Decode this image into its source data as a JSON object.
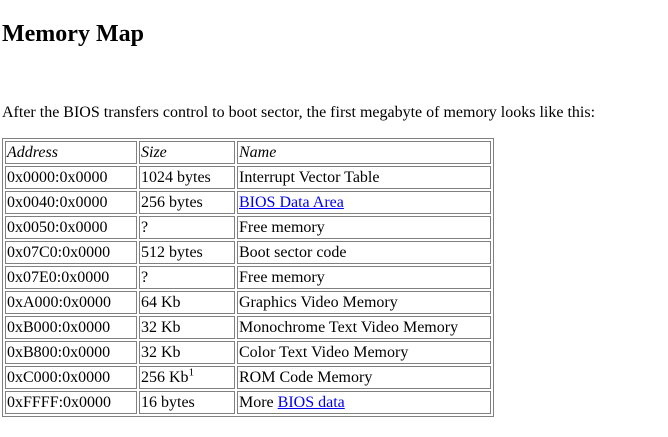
{
  "title": "Memory Map",
  "intro": "After the BIOS transfers control to boot sector, the first megabyte of memory looks like this:",
  "table": {
    "headers": [
      "Address",
      "Size",
      "Name"
    ],
    "rows": [
      {
        "address": "0x0000:0x0000",
        "size": "1024 bytes",
        "name": "Interrupt Vector Table"
      },
      {
        "address": "0x0040:0x0000",
        "size": "256 bytes",
        "name_link": "BIOS Data Area"
      },
      {
        "address": "0x0050:0x0000",
        "size": "?",
        "name": "Free memory"
      },
      {
        "address": "0x07C0:0x0000",
        "size": "512 bytes",
        "name": "Boot sector code"
      },
      {
        "address": "0x07E0:0x0000",
        "size": "?",
        "name": "Free memory"
      },
      {
        "address": "0xA000:0x0000",
        "size": "64 Kb",
        "name": "Graphics Video Memory"
      },
      {
        "address": "0xB000:0x0000",
        "size": "32 Kb",
        "name": "Monochrome Text Video Memory"
      },
      {
        "address": "0xB800:0x0000",
        "size": "32 Kb",
        "name": "Color Text Video Memory"
      },
      {
        "address": "0xC000:0x0000",
        "size": "256 Kb",
        "size_footnote": "1",
        "name": "ROM Code Memory"
      },
      {
        "address": "0xFFFF:0x0000",
        "size": "16 bytes",
        "name_prefix": "More ",
        "name_link": "BIOS data"
      }
    ]
  },
  "colors": {
    "link": "#0000ee",
    "border": "#808080"
  }
}
